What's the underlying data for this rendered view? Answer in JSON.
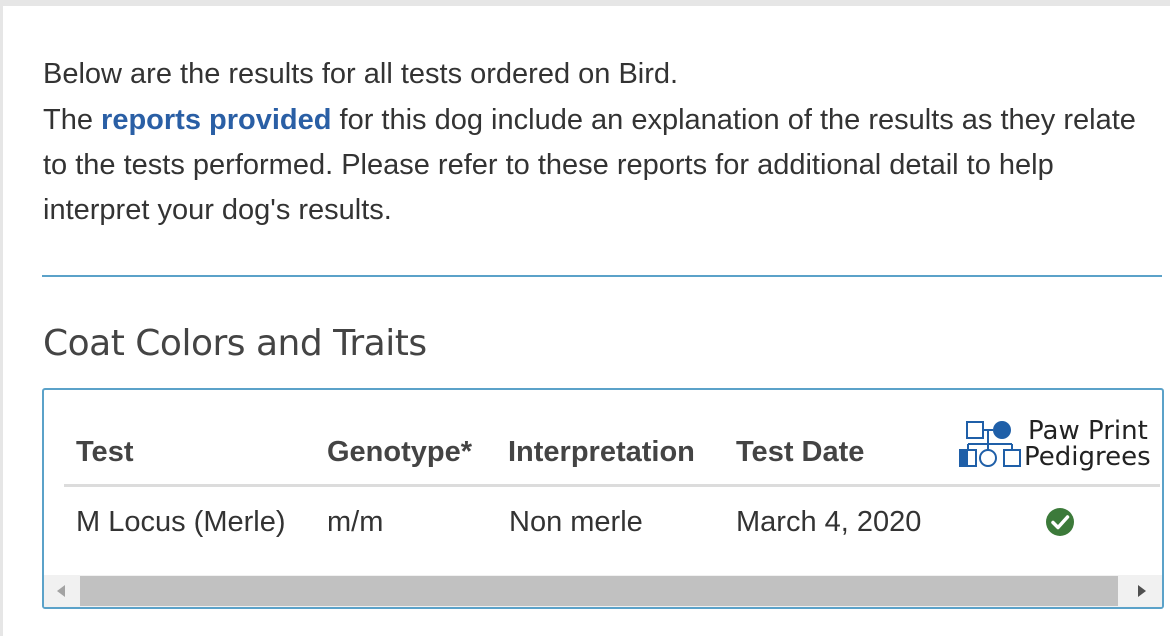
{
  "intro": {
    "line1": "Below are the results for all tests ordered on Bird.",
    "line2_before": "The ",
    "link_text": "reports provided",
    "line2_after": " for this dog include an explanation of the results as they relate to the tests performed. Please refer to these reports for additional detail to help interpret your dog's results."
  },
  "section": {
    "title": "Coat Colors and Traits"
  },
  "table": {
    "headers": {
      "test": "Test",
      "genotype": "Genotype*",
      "interpretation": "Interpretation",
      "test_date": "Test Date",
      "ppp_line1": "Paw Print",
      "ppp_line2": "Pedigrees"
    },
    "rows": [
      {
        "test": "M Locus (Merle)",
        "genotype": "m/m",
        "interpretation": "Non merle",
        "test_date": "March 4, 2020",
        "ppp_icon": "check-circle-icon"
      }
    ]
  },
  "icons": {
    "ppp_logo": "pedigree-chart-icon",
    "check": "check-circle-icon",
    "scroll_left": "triangle-left-icon",
    "scroll_right": "triangle-right-icon"
  },
  "colors": {
    "link": "#2a5fa5",
    "accent_border": "#5ba2c9",
    "check_green": "#3c7a3a",
    "logo_blue": "#1f5fa8"
  }
}
